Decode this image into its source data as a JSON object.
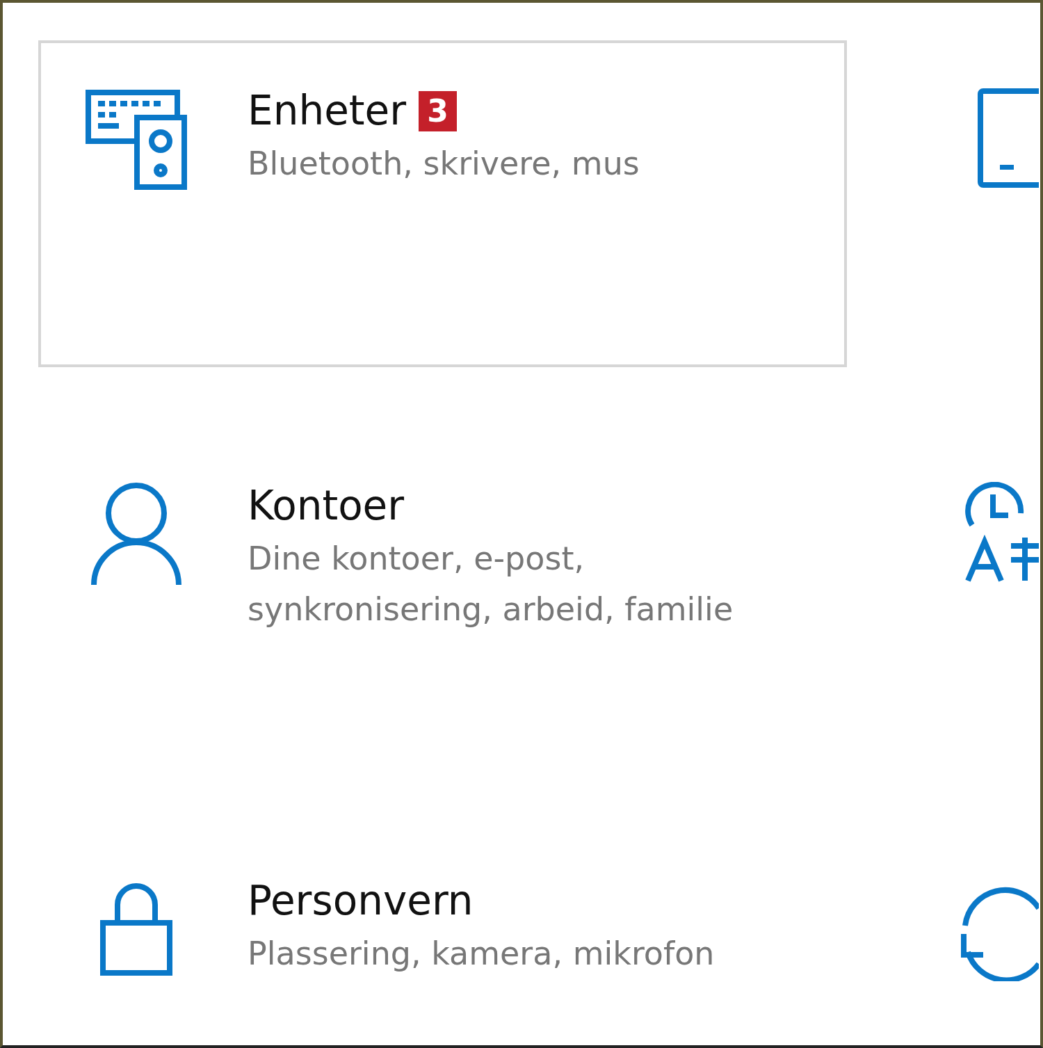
{
  "tiles": [
    {
      "kind": "devices",
      "title": "Enheter",
      "badge": "3",
      "subtitle": "Bluetooth, skrivere, mus",
      "selected": true
    },
    {
      "kind": "account",
      "title": "Kontoer",
      "subtitle": "Dine kontoer, e-post, synkronisering, arbeid, familie",
      "selected": false
    },
    {
      "kind": "privacy",
      "title": "Personvern",
      "subtitle": "Plassering, kamera, mikrofon",
      "selected": false
    }
  ],
  "right_tiles": [
    {
      "kind": "phone"
    },
    {
      "kind": "time-language"
    },
    {
      "kind": "update"
    }
  ]
}
